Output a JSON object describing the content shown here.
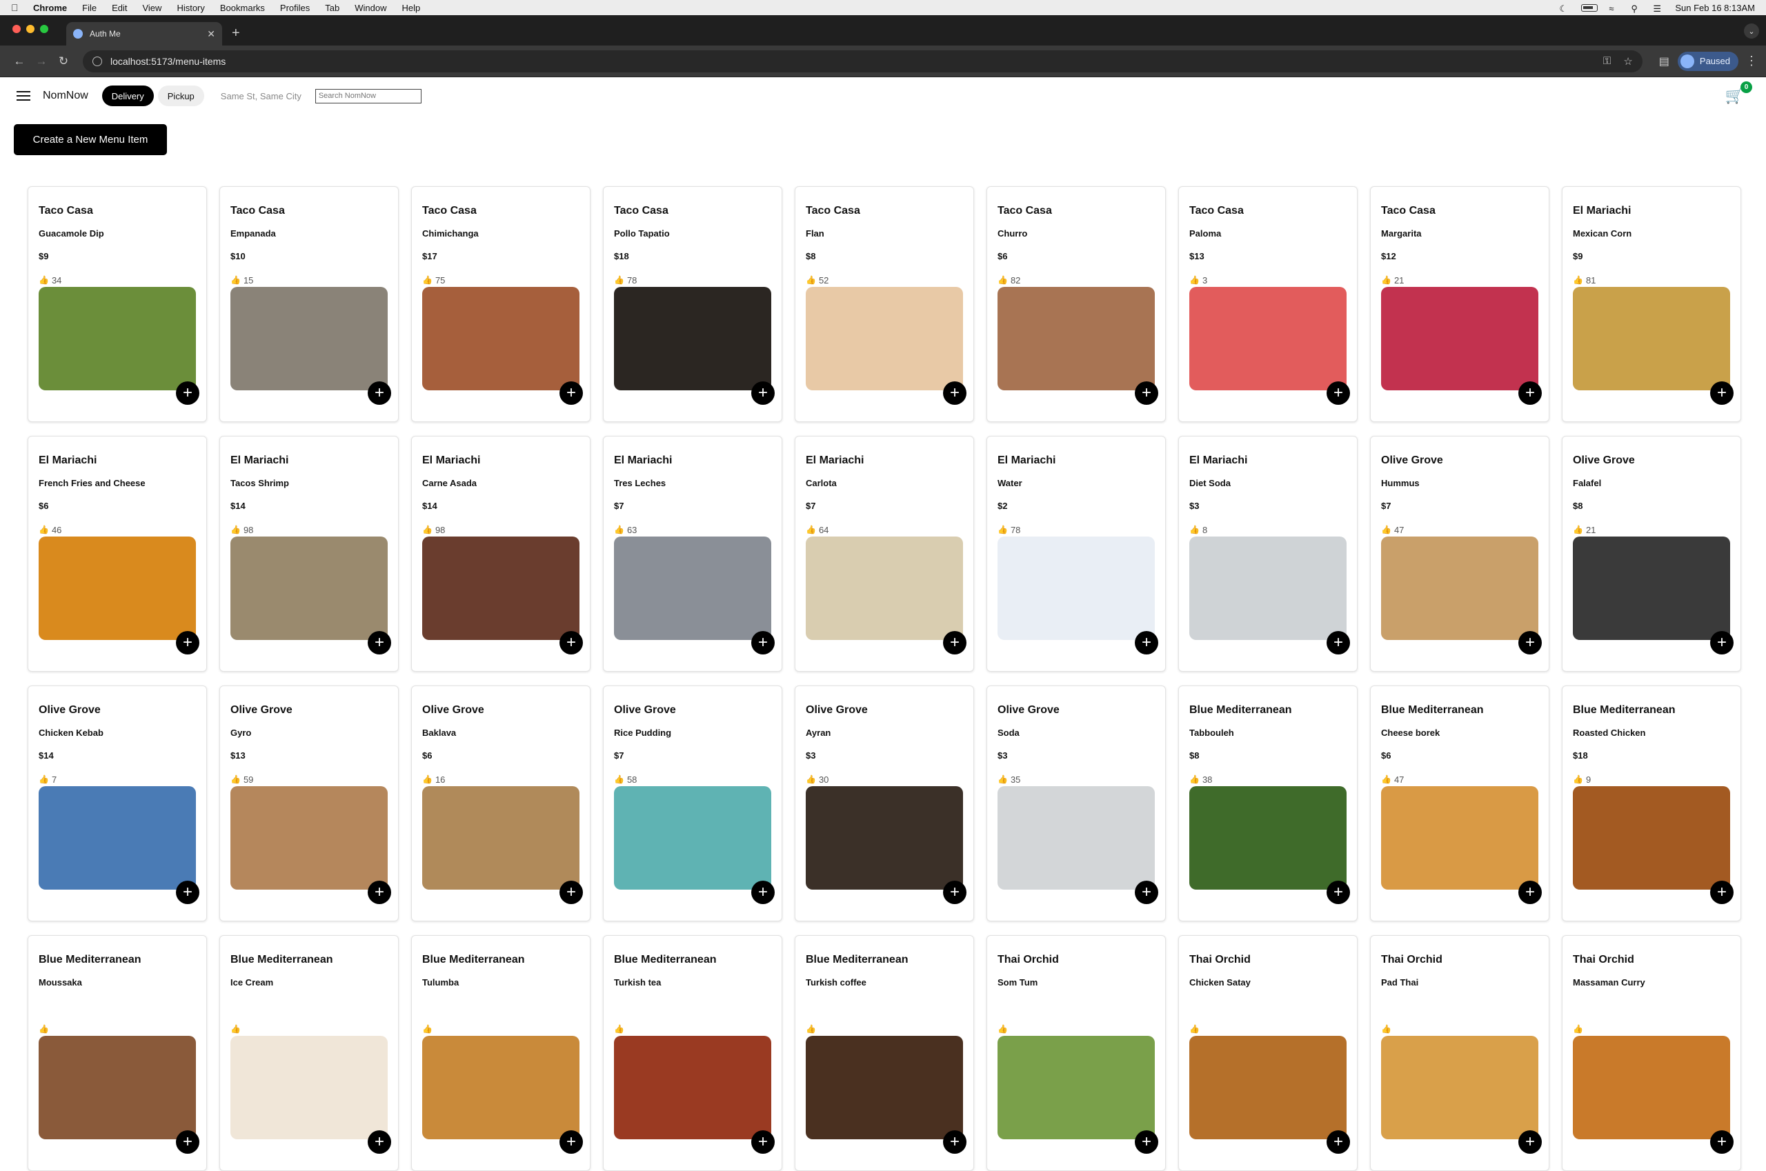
{
  "menubar": {
    "app": "Chrome",
    "items": [
      "File",
      "Edit",
      "View",
      "History",
      "Bookmarks",
      "Profiles",
      "Tab",
      "Window",
      "Help"
    ],
    "clock": "Sun Feb 16  8:13AM"
  },
  "browser": {
    "tab_title": "Auth Me",
    "url": "localhost:5173/menu-items",
    "profile_status": "Paused"
  },
  "app": {
    "brand": "NomNow",
    "delivery_label": "Delivery",
    "pickup_label": "Pickup",
    "address": "Same St, Same City",
    "search_placeholder": "Search NomNow",
    "cart_count": "0",
    "create_button": "Create a New Menu Item"
  },
  "menu_items": [
    {
      "restaurant": "Taco Casa",
      "name": "Guacamole Dip",
      "price": "$9",
      "likes": "34",
      "color": "#6b8e3a"
    },
    {
      "restaurant": "Taco Casa",
      "name": "Empanada",
      "price": "$10",
      "likes": "15",
      "color": "#8a8378"
    },
    {
      "restaurant": "Taco Casa",
      "name": "Chimichanga",
      "price": "$17",
      "likes": "75",
      "color": "#a65f3c"
    },
    {
      "restaurant": "Taco Casa",
      "name": "Pollo Tapatio",
      "price": "$18",
      "likes": "78",
      "color": "#2b2622"
    },
    {
      "restaurant": "Taco Casa",
      "name": "Flan",
      "price": "$8",
      "likes": "52",
      "color": "#e8c9a6"
    },
    {
      "restaurant": "Taco Casa",
      "name": "Churro",
      "price": "$6",
      "likes": "82",
      "color": "#a87453"
    },
    {
      "restaurant": "Taco Casa",
      "name": "Paloma",
      "price": "$13",
      "likes": "3",
      "color": "#e25c5c"
    },
    {
      "restaurant": "Taco Casa",
      "name": "Margarita",
      "price": "$12",
      "likes": "21",
      "color": "#c2324f"
    },
    {
      "restaurant": "El Mariachi",
      "name": "Mexican Corn",
      "price": "$9",
      "likes": "81",
      "color": "#c9a14a"
    },
    {
      "restaurant": "El Mariachi",
      "name": "French Fries and Cheese",
      "price": "$6",
      "likes": "46",
      "color": "#d98a1e"
    },
    {
      "restaurant": "El Mariachi",
      "name": "Tacos Shrimp",
      "price": "$14",
      "likes": "98",
      "color": "#9a8a6e"
    },
    {
      "restaurant": "El Mariachi",
      "name": "Carne Asada",
      "price": "$14",
      "likes": "98",
      "color": "#6a3d2e"
    },
    {
      "restaurant": "El Mariachi",
      "name": "Tres Leches",
      "price": "$7",
      "likes": "63",
      "color": "#8a8f97"
    },
    {
      "restaurant": "El Mariachi",
      "name": "Carlota",
      "price": "$7",
      "likes": "64",
      "color": "#d9cdb0"
    },
    {
      "restaurant": "El Mariachi",
      "name": "Water",
      "price": "$2",
      "likes": "78",
      "color": "#e9eef5"
    },
    {
      "restaurant": "El Mariachi",
      "name": "Diet Soda",
      "price": "$3",
      "likes": "8",
      "color": "#cfd3d6"
    },
    {
      "restaurant": "Olive Grove",
      "name": "Hummus",
      "price": "$7",
      "likes": "47",
      "color": "#c9a06a"
    },
    {
      "restaurant": "Olive Grove",
      "name": "Falafel",
      "price": "$8",
      "likes": "21",
      "color": "#3a3a3a"
    },
    {
      "restaurant": "Olive Grove",
      "name": "Chicken Kebab",
      "price": "$14",
      "likes": "7",
      "color": "#4a7bb5"
    },
    {
      "restaurant": "Olive Grove",
      "name": "Gyro",
      "price": "$13",
      "likes": "59",
      "color": "#b5875c"
    },
    {
      "restaurant": "Olive Grove",
      "name": "Baklava",
      "price": "$6",
      "likes": "16",
      "color": "#b08a5a"
    },
    {
      "restaurant": "Olive Grove",
      "name": "Rice Pudding",
      "price": "$7",
      "likes": "58",
      "color": "#5fb3b3"
    },
    {
      "restaurant": "Olive Grove",
      "name": "Ayran",
      "price": "$3",
      "likes": "30",
      "color": "#3b3028"
    },
    {
      "restaurant": "Olive Grove",
      "name": "Soda",
      "price": "$3",
      "likes": "35",
      "color": "#d3d6d8"
    },
    {
      "restaurant": "Blue Mediterranean",
      "name": "Tabbouleh",
      "price": "$8",
      "likes": "38",
      "color": "#3f6b2a"
    },
    {
      "restaurant": "Blue Mediterranean",
      "name": "Cheese borek",
      "price": "$6",
      "likes": "47",
      "color": "#d99a45"
    },
    {
      "restaurant": "Blue Mediterranean",
      "name": "Roasted Chicken",
      "price": "$18",
      "likes": "9",
      "color": "#a35a22"
    },
    {
      "restaurant": "Blue Mediterranean",
      "name": "Moussaka",
      "price": "",
      "likes": "",
      "color": "#8a5a3a"
    },
    {
      "restaurant": "Blue Mediterranean",
      "name": "Ice Cream",
      "price": "",
      "likes": "",
      "color": "#f0e6d8"
    },
    {
      "restaurant": "Blue Mediterranean",
      "name": "Tulumba",
      "price": "",
      "likes": "",
      "color": "#c98a3a"
    },
    {
      "restaurant": "Blue Mediterranean",
      "name": "Turkish tea",
      "price": "",
      "likes": "",
      "color": "#9a3a22"
    },
    {
      "restaurant": "Blue Mediterranean",
      "name": "Turkish coffee",
      "price": "",
      "likes": "",
      "color": "#4a3020"
    },
    {
      "restaurant": "Thai Orchid",
      "name": "Som Tum",
      "price": "",
      "likes": "",
      "color": "#7aa04a"
    },
    {
      "restaurant": "Thai Orchid",
      "name": "Chicken Satay",
      "price": "",
      "likes": "",
      "color": "#b5702a"
    },
    {
      "restaurant": "Thai Orchid",
      "name": "Pad Thai",
      "price": "",
      "likes": "",
      "color": "#d9a04a"
    },
    {
      "restaurant": "Thai Orchid",
      "name": "Massaman Curry",
      "price": "",
      "likes": "",
      "color": "#c97a2a"
    }
  ]
}
